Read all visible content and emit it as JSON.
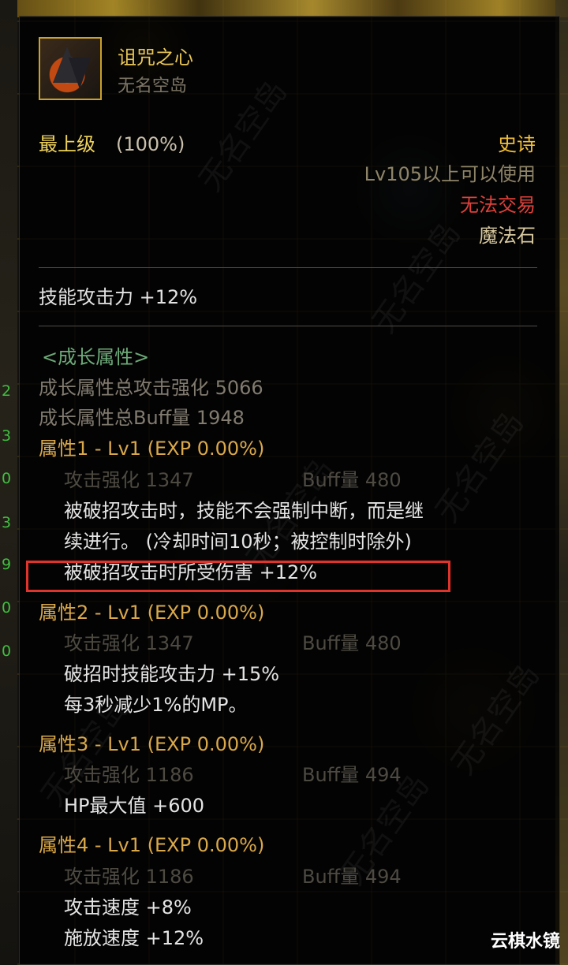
{
  "item": {
    "name": "诅咒之心",
    "source": "无名空岛",
    "icon": "dark-stone-shard-icon",
    "grade_label": "最上级",
    "grade_pct": "(100%)",
    "rarity": "史诗",
    "level_req": "Lv105以上可以使用",
    "trade": "无法交易",
    "type": "魔法石",
    "skill_atk": "技能攻击力  +12%"
  },
  "growth": {
    "header": "<成长属性>",
    "total_atk": "成长属性总攻击强化 5066",
    "total_buff": "成长属性总Buff量 1948",
    "props": [
      {
        "header": "属性1 - Lv1 (EXP 0.00%)",
        "atk": "攻击强化  1347",
        "buff": "Buff量  480",
        "effects": [
          "被破招攻击时，技能不会强制中断，而是继",
          "续进行。 (冷却时间10秒；被控制时除外)",
          "被破招攻击时所受伤害 +12%"
        ]
      },
      {
        "header": "属性2 - Lv1 (EXP 0.00%)",
        "atk": "攻击强化  1347",
        "buff": "Buff量  480",
        "effects": [
          "破招时技能攻击力 +15%",
          "每3秒减少1%的MP。"
        ]
      },
      {
        "header": "属性3 - Lv1 (EXP 0.00%)",
        "atk": "攻击强化  1186",
        "buff": "Buff量  494",
        "effects": [
          "HP最大值 +600"
        ]
      },
      {
        "header": "属性4 - Lv1 (EXP 0.00%)",
        "atk": "攻击强化  1186",
        "buff": "Buff量  494",
        "effects": [
          "攻击速度 +8%",
          "施放速度 +12%"
        ]
      }
    ]
  },
  "side_numbers": [
    "2",
    "3",
    "0",
    "3",
    "9",
    "0",
    "0"
  ],
  "watermark": "无名空岛",
  "site_tag": "云棋水镜",
  "colors": {
    "rarity": "#f2c039",
    "untradable": "#e0403a",
    "growth_header": "#6dab79",
    "prop_header": "#d9a84a",
    "highlight_box": "#e0332c"
  }
}
